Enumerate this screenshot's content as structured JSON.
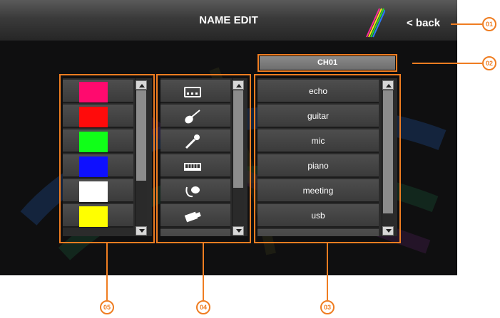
{
  "header": {
    "title": "NAME EDIT",
    "back_label": "< back"
  },
  "channel": {
    "label": "CH01"
  },
  "color_list": {
    "colors": [
      "#ff0a6e",
      "#ff0b0b",
      "#10ff18",
      "#0e10ff",
      "#ffffff",
      "#ffff00"
    ]
  },
  "icon_list": {
    "icons": [
      "mixer-icon",
      "guitar-icon",
      "microphone-icon",
      "keyboard-icon",
      "headset-mic-icon",
      "usb-icon",
      "partial-icon"
    ]
  },
  "name_list": {
    "names": [
      "echo",
      "guitar",
      "mic",
      "piano",
      "meeting",
      "usb"
    ]
  },
  "callouts": {
    "back": "01",
    "channel": "02",
    "names": "03",
    "icons": "04",
    "colors": "05"
  }
}
